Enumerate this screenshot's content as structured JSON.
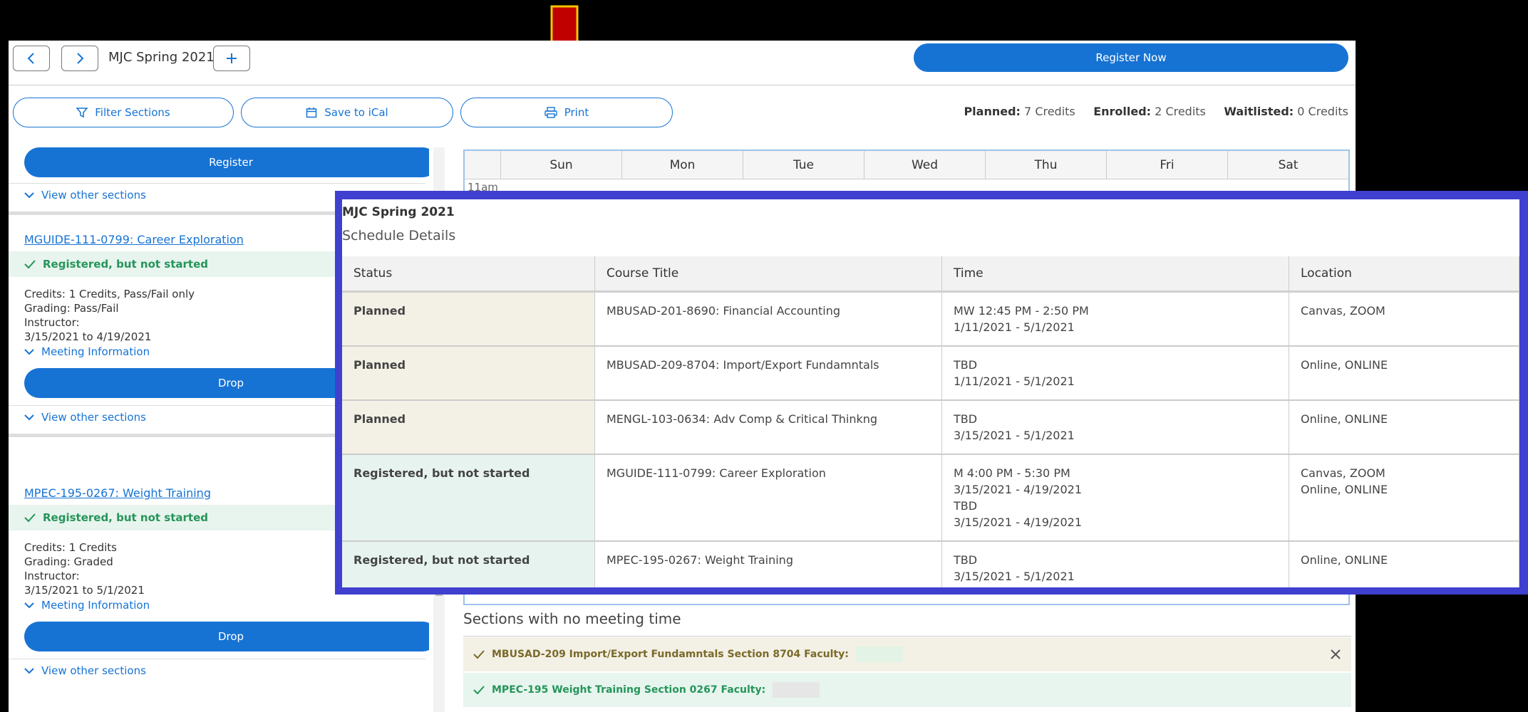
{
  "toolbar": {
    "term": "MJC Spring 2021",
    "register_now": "Register Now",
    "filter_label": "Filter Sections",
    "ical_label": "Save to iCal",
    "print_label": "Print"
  },
  "credits": {
    "planned_label": "Planned:",
    "planned_value": "7 Credits",
    "enrolled_label": "Enrolled:",
    "enrolled_value": "2 Credits",
    "waitlisted_label": "Waitlisted:",
    "waitlisted_value": "0 Credits"
  },
  "sidebar": {
    "register_label": "Register",
    "view_other_sections": "View other sections",
    "course1": {
      "title": "MGUIDE-111-0799: Career Exploration",
      "status": "Registered, but not started",
      "credits": "Credits: 1 Credits, Pass/Fail only",
      "grading": "Grading: Pass/Fail",
      "instructor": "Instructor:",
      "dates": "3/15/2021 to 4/19/2021",
      "meeting_info": "Meeting Information",
      "drop": "Drop",
      "view_other": "View other sections"
    },
    "course2": {
      "title": "MPEC-195-0267: Weight Training",
      "status": "Registered, but not started",
      "credits": "Credits: 1 Credits",
      "grading": "Grading: Graded",
      "instructor": "Instructor:",
      "dates": "3/15/2021 to 5/1/2021",
      "meeting_info": "Meeting Information",
      "drop": "Drop",
      "view_other": "View other sections"
    }
  },
  "calendar": {
    "days": [
      "Sun",
      "Mon",
      "Tue",
      "Wed",
      "Thu",
      "Fri",
      "Sat"
    ],
    "first_time": "11am"
  },
  "no_meeting": {
    "title": "Sections with no meeting time",
    "rows": [
      {
        "text": "MBUSAD-209 Import/Export Fundamntals Section 8704 Faculty:",
        "color": "#7a6a2a",
        "bg": "#f3f0e5"
      },
      {
        "text": "MPEC-195 Weight Training Section 0267 Faculty:",
        "color": "#25955a",
        "bg": "#e7f5ee"
      }
    ]
  },
  "overlay": {
    "term": "MJC Spring 2021",
    "subtitle": "Schedule Details",
    "headers": [
      "Status",
      "Course Title",
      "Time",
      "Location"
    ],
    "rows": [
      {
        "status": "Planned",
        "kind": "planned",
        "course": "MBUSAD-201-8690: Financial Accounting",
        "time": [
          "MW 12:45 PM - 2:50 PM",
          "1/11/2021 - 5/1/2021"
        ],
        "location": [
          "Canvas, ZOOM"
        ]
      },
      {
        "status": "Planned",
        "kind": "planned",
        "course": "MBUSAD-209-8704: Import/Export Fundamntals",
        "time": [
          "TBD",
          "1/11/2021 - 5/1/2021"
        ],
        "location": [
          "Online, ONLINE"
        ]
      },
      {
        "status": "Planned",
        "kind": "planned",
        "course": "MENGL-103-0634: Adv Comp & Critical Thinkng",
        "time": [
          "TBD",
          "3/15/2021 - 5/1/2021"
        ],
        "location": [
          "Online, ONLINE"
        ]
      },
      {
        "status": "Registered, but not started",
        "kind": "reg",
        "course": "MGUIDE-111-0799: Career Exploration",
        "time": [
          "M 4:00 PM - 5:30 PM",
          "3/15/2021 - 4/19/2021",
          "TBD",
          "3/15/2021 - 4/19/2021"
        ],
        "location": [
          "Canvas, ZOOM",
          "Online, ONLINE"
        ]
      },
      {
        "status": "Registered, but not started",
        "kind": "reg",
        "course": "MPEC-195-0267: Weight Training",
        "time": [
          "TBD",
          "3/15/2021 - 5/1/2021"
        ],
        "location": [
          "Online, ONLINE"
        ]
      }
    ]
  },
  "colors": {
    "accent": "#1673d4",
    "overlay_border": "#3f3fd0",
    "arrow": "#c00000",
    "arrow_outline": "#f5c400"
  }
}
